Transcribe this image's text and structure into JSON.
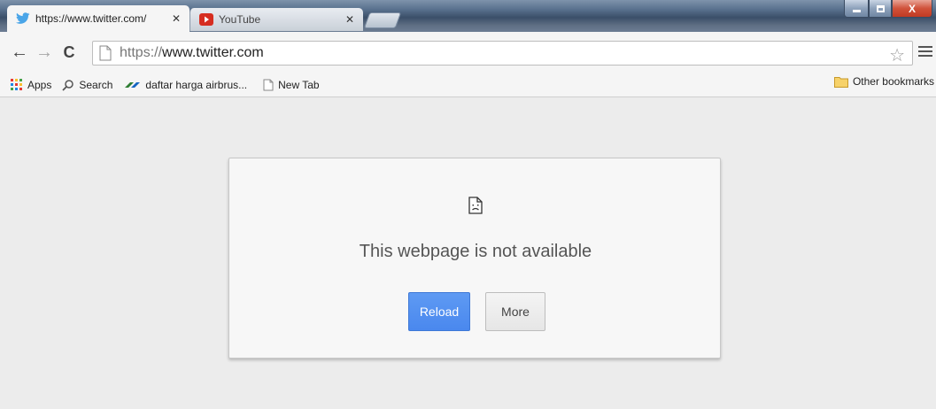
{
  "tabs": [
    {
      "title": "https://www.twitter.com/",
      "favicon": "twitter-bird-icon",
      "active": true
    },
    {
      "title": "YouTube",
      "favicon": "youtube-icon",
      "active": false
    }
  ],
  "toolbar": {
    "url_scheme": "https://",
    "url_host": "www.twitter.com"
  },
  "bookmarks": [
    {
      "label": "Apps",
      "icon": "apps-grid-icon"
    },
    {
      "label": "Search",
      "icon": "search-icon"
    },
    {
      "label": "daftar harga airbrus...",
      "icon": "airbrush-favicon"
    },
    {
      "label": "New Tab",
      "icon": "page-icon"
    }
  ],
  "other_bookmarks": "Other bookmarks",
  "error": {
    "title": "This webpage is not available",
    "reload_label": "Reload",
    "more_label": "More"
  },
  "colors": {
    "reload_button": "#4a88ee",
    "page_background": "#ececec",
    "card_background": "#f7f7f7"
  }
}
